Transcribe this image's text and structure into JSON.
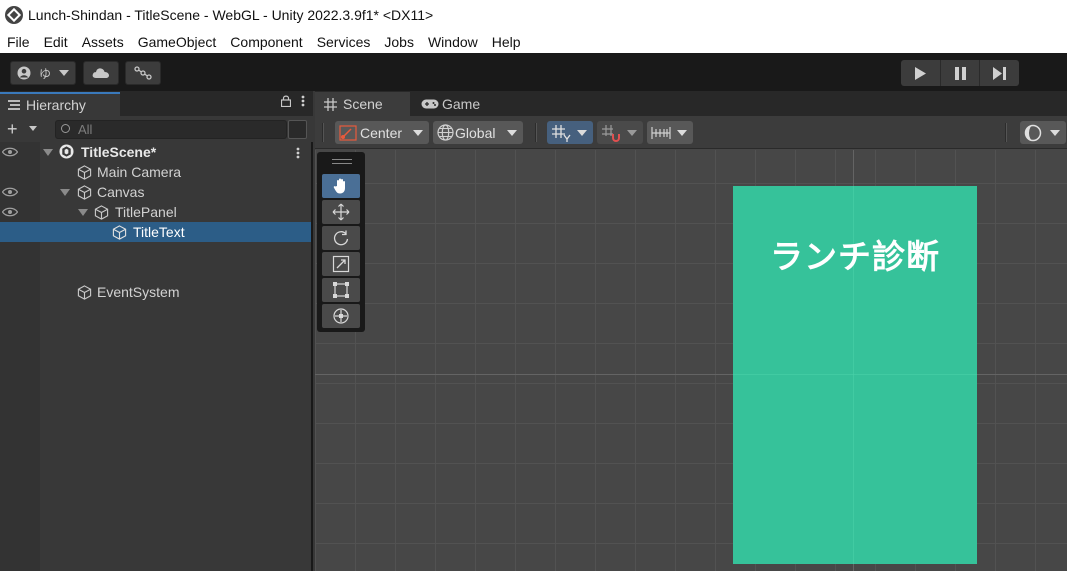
{
  "window": {
    "title": "Lunch-Shindan - TitleScene - WebGL - Unity 2022.3.9f1* <DX11>"
  },
  "menu": [
    "File",
    "Edit",
    "Assets",
    "GameObject",
    "Component",
    "Services",
    "Jobs",
    "Window",
    "Help"
  ],
  "toolbar": {
    "account_label": "ゆ"
  },
  "hierarchy": {
    "tab_label": "Hierarchy",
    "search_placeholder": "All",
    "scene_name": "TitleScene*",
    "items": [
      "Main Camera",
      "Canvas",
      "TitlePanel",
      "TitleText",
      "EventSystem"
    ],
    "selected": "TitleText"
  },
  "scene": {
    "tabs": [
      "Scene",
      "Game"
    ],
    "active_tab": "Scene",
    "pivot_label": "Center",
    "space_label": "Global",
    "canvas_text": "ランチ診断",
    "canvas_color": "#36c29a"
  },
  "colors": {
    "selection": "#2c5d87",
    "tab_accent": "#3a79bb"
  }
}
